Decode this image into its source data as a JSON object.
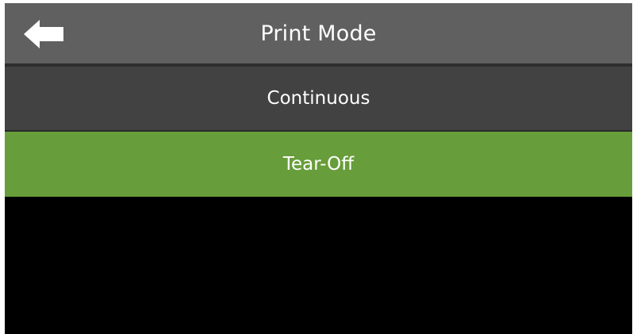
{
  "header": {
    "title": "Print Mode",
    "back_icon": "arrow-left-icon"
  },
  "menu": {
    "items": [
      {
        "label": "Continuous",
        "selected": false
      },
      {
        "label": "Tear-Off",
        "selected": true
      }
    ]
  },
  "colors": {
    "header_bg": "#606060",
    "item_bg": "#424242",
    "selected_bg": "#679d3a",
    "screen_bg": "#000000",
    "text": "#ffffff"
  }
}
